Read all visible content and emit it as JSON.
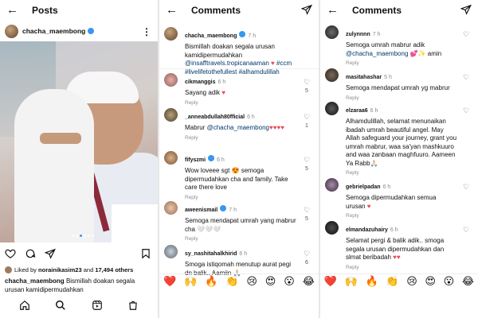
{
  "panel1": {
    "title": "Posts",
    "username": "chacha_maembong",
    "liked_by_user": "norainikasim23",
    "liked_by_others": "17,494 others",
    "caption_text": "Bismillah doakan segala urusan kamidipermudahkan"
  },
  "panel2": {
    "title": "Comments",
    "comments": [
      {
        "user": "chacha_maembong",
        "time": "7 h",
        "text": "Bismillah doakan segala urusan kamidipermudahkan",
        "mention": "@insafftravels.tropicanaaman",
        "hashtags": "#ccm #livelifetothefullest #alhamdulillah",
        "verified": true,
        "is_caption": true
      },
      {
        "user": "cikmanggis",
        "time": "6 h",
        "text": "Sayang adik",
        "emoji": "♥",
        "reply": "Reply",
        "likes": "5"
      },
      {
        "user": "_anneabdullah80fficial",
        "time": "6 h",
        "text": "Mabrur",
        "mention": "@chacha_maembong",
        "emoji": "♥♥♥♥",
        "reply": "Reply",
        "likes": "1"
      },
      {
        "user": "fifyszmi",
        "time": "6 h",
        "text": "Wow loveee sgt 😍 semoga dipermudahkan cha and family. Take care there love",
        "reply": "Reply",
        "likes": "5"
      },
      {
        "user": "aweenismail",
        "time": "7 h",
        "text": "Semoga mendapat umrah yang mabrur cha",
        "emoji": "🤍🤍🤍",
        "reply": "Reply",
        "likes": "5"
      },
      {
        "user": "sy_nashitahalkhirid",
        "time": "6 h",
        "text": "Smoga istiqomah menutup aurat pegi dn balik.. Aamiin 🙏🏻",
        "reply": "Reply",
        "likes": "6"
      }
    ]
  },
  "panel3": {
    "title": "Comments",
    "comments": [
      {
        "user": "zulynnnn",
        "time": "7 h",
        "text": "Semoga umrah mabrur adik",
        "mention": "@chacha_maembong",
        "tail": "💕✨ amin",
        "reply": "Reply"
      },
      {
        "user": "masitahashar",
        "time": "5 h",
        "text": "Semoga mendapat umrah yg mabrur",
        "reply": "Reply"
      },
      {
        "user": "elzaraa6",
        "time": "6 h",
        "text": "Alhamdulillah, selamat menunaikan ibadah umrah beautiful angel. May Allah safeguard your journey, grant you umrah mabrur, waa sa'yan mashkuuro and waa zanbaan maghfuuro. Aameen Ya Rabb🙏🏻",
        "reply": "Reply"
      },
      {
        "user": "gebrielpadan",
        "time": "6 h",
        "text": "Semoga dipermudahkan semua urusan",
        "emoji": "♥",
        "reply": "Reply"
      },
      {
        "user": "elmandazuhairy",
        "time": "6 h",
        "text": "Selamat pergi & balik adik.. smoga segala urusan dipermudahkan dan slmat beribadah",
        "emoji": "♥♥",
        "reply": "Reply"
      }
    ]
  },
  "emoji_bar": [
    "❤️",
    "🙌",
    "🔥",
    "👏",
    "😢",
    "😍",
    "😮",
    "😂"
  ],
  "watermark_text": "mi",
  "colors": {
    "link": "#00376b",
    "verified": "#3897f0",
    "heart": "#ed4956",
    "muted": "#8e8e8e"
  }
}
